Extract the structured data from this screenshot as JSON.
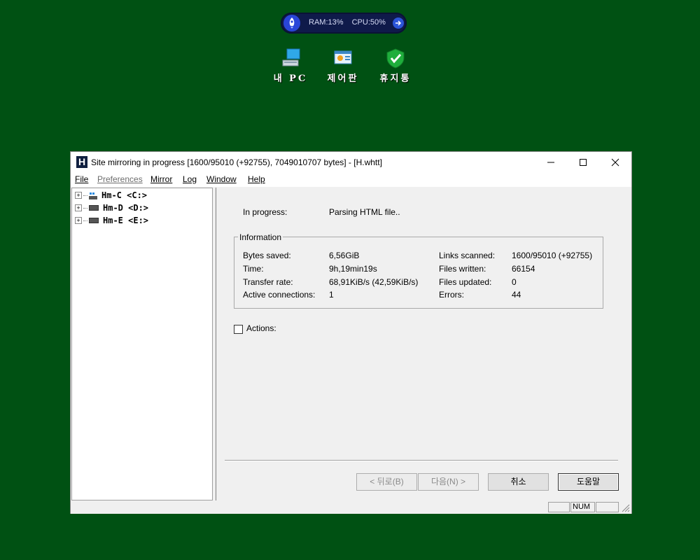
{
  "monitor": {
    "ram": "RAM:13%",
    "cpu": "CPU:50%"
  },
  "desktop": [
    {
      "label": "내 PC",
      "icon": "computer-icon"
    },
    {
      "label": "제어판",
      "icon": "control-panel-icon"
    },
    {
      "label": "휴지통",
      "icon": "recycle-bin-shield-icon"
    }
  ],
  "window": {
    "title": "Site mirroring in progress [1600/95010 (+92755), 7049010707 bytes] - [H.whtt]",
    "menu": [
      {
        "label": "File",
        "disabled": false
      },
      {
        "label": "Preferences",
        "disabled": true
      },
      {
        "label": "Mirror",
        "disabled": false
      },
      {
        "label": "Log",
        "disabled": false
      },
      {
        "label": "Window",
        "disabled": false
      },
      {
        "label": "Help",
        "disabled": false
      }
    ],
    "tree": [
      "Hm-C <C:>",
      "Hm-D <D:>",
      "Hm-E <E:>"
    ],
    "progress": {
      "label": "In progress:",
      "value": "Parsing HTML file.."
    },
    "info": {
      "title": "Information",
      "bytes_saved_label": "Bytes saved:",
      "bytes_saved": "6,56GiB",
      "time_label": "Time:",
      "time": "9h,19min19s",
      "transfer_label": "Transfer rate:",
      "transfer": "68,91KiB/s (42,59KiB/s)",
      "active_label": "Active connections:",
      "active": "1",
      "links_label": "Links scanned:",
      "links": "1600/95010 (+92755)",
      "written_label": "Files written:",
      "written": "66154",
      "updated_label": "Files updated:",
      "updated": "0",
      "errors_label": "Errors:",
      "errors": "44"
    },
    "actions_label": "Actions:",
    "buttons": {
      "back": "< 뒤로(B)",
      "next": "다음(N) >",
      "cancel": "취소",
      "help": "도움말"
    },
    "status": {
      "num": "NUM"
    }
  }
}
